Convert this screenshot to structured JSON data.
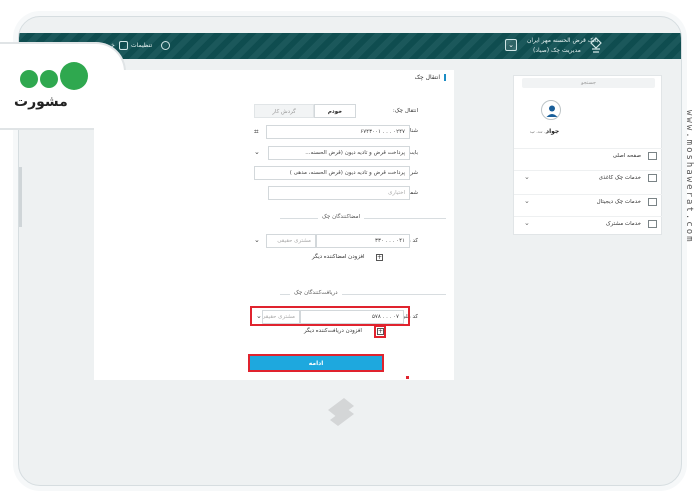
{
  "topbar": {
    "bank_name": "بانک قرض الحسنه مهر ایران",
    "section": "مدیریت چک (صیاد)",
    "settings_label": "تنظیمات",
    "exit_label": "خروج"
  },
  "logo": {
    "text": "مشورت"
  },
  "page": {
    "header": "انتقال چک"
  },
  "form": {
    "transferor": {
      "label": "انتقال چک:",
      "seg_active": "خودم",
      "seg_inactive": "گردش کار"
    },
    "sayad": {
      "label": "شناسه صیاد چک:",
      "value": "۰۲۴۷ . . . ۶۷۴۳۰۰۱"
    },
    "reason": {
      "label": "بابت:",
      "value": "پرداخت قرض و تادیه دیون (قرض الحسنه..."
    },
    "description": {
      "label": "شرح انتقال چک:",
      "value": "پرداخت قرض و تادیه دیون (قرض الحسنه، مدهی )"
    },
    "account": {
      "label": "شماره شبای مقصد:",
      "placeholder": "اختیاری"
    },
    "signers_section": "امضاکنندگان چک",
    "signer": {
      "label": "کد ملی:",
      "value": "۰۴۱ . . . ۳۳۰",
      "type": "مشتری حقیقی"
    },
    "add_signer": "افزودن امضاکننده دیگر",
    "receivers_section": "دریافت‌کنندگان چک",
    "receiver": {
      "label": "کد ملی:",
      "value": "۰۷ . . . ۵۷۸",
      "type": "مشتری حقیقی"
    },
    "add_receiver": "افزودن دریافت‌کننده دیگر",
    "continue": "ادامه"
  },
  "sidebar": {
    "search_placeholder": "جستجو",
    "user_name": "جواد",
    "user_sub": "ر. ت. ب",
    "items": [
      {
        "label": "صفحه اصلی",
        "icon": "home-icon"
      },
      {
        "label": "خدمات چک کاغذی",
        "icon": "paper-check-icon"
      },
      {
        "label": "خدمات چک دیجیتال",
        "icon": "digital-check-icon"
      },
      {
        "label": "خدمات مشترک",
        "icon": "shared-services-icon"
      }
    ]
  },
  "side_url": "www.moshawerat.com"
}
